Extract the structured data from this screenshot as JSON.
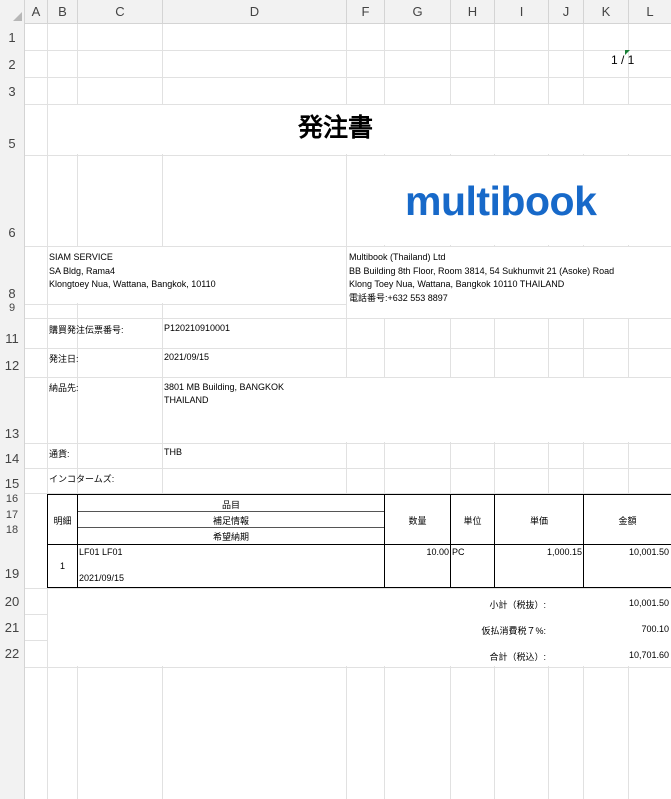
{
  "columns": [
    "A",
    "B",
    "C",
    "D",
    "F",
    "G",
    "H",
    "I",
    "J",
    "K",
    "L"
  ],
  "rows": [
    "1",
    "2",
    "3",
    "5",
    "6",
    "8",
    "9",
    "11",
    "12",
    "13",
    "14",
    "15",
    "16",
    "17",
    "18",
    "19",
    "20",
    "21",
    "22"
  ],
  "page_number": "1 / 1",
  "title": "発注書",
  "logo_text": "multibook",
  "supplier": {
    "line1": "SIAM SERVICE",
    "line2": "SA Bldg, Rama4",
    "line3": "Klongtoey Nua, Wattana, Bangkok, 10110"
  },
  "buyer": {
    "line1": "Multibook (Thailand) Ltd",
    "line2": "BB Building 8th Floor, Room 3814, 54 Sukhumvit 21 (Asoke) Road",
    "line3": "Klong Toey Nua, Wattana, Bangkok 10110 THAILAND",
    "line4": "電話番号:+632 553 8897"
  },
  "fields": {
    "po_number_label": "購買発注伝票番号:",
    "po_number_value": "P120210910001",
    "order_date_label": "発注日:",
    "order_date_value": "2021/09/15",
    "delivery_label": "納品先:",
    "delivery_line1": "3801 MB Building, BANGKOK",
    "delivery_line2": "THAILAND",
    "currency_label": "通貨:",
    "currency_value": "THB",
    "incoterms_label": "インコタームズ:"
  },
  "table": {
    "headers": {
      "line_no": "明細",
      "item": "品目",
      "supplement": "補足情報",
      "desired_date": "希望納期",
      "qty": "数量",
      "unit": "単位",
      "unit_price": "単価",
      "amount": "金額"
    },
    "row": {
      "line_no": "1",
      "item": "LF01 LF01",
      "date": "2021/09/15",
      "qty": "10.00",
      "unit": "PC",
      "unit_price": "1,000.15",
      "amount": "10,001.50"
    }
  },
  "totals": {
    "subtotal_label": "小計（税抜）:",
    "subtotal_value": "10,001.50",
    "vat_label": "仮払消費税７%:",
    "vat_value": "700.10",
    "total_label": "合計（税込）:",
    "total_value": "10,701.60"
  }
}
